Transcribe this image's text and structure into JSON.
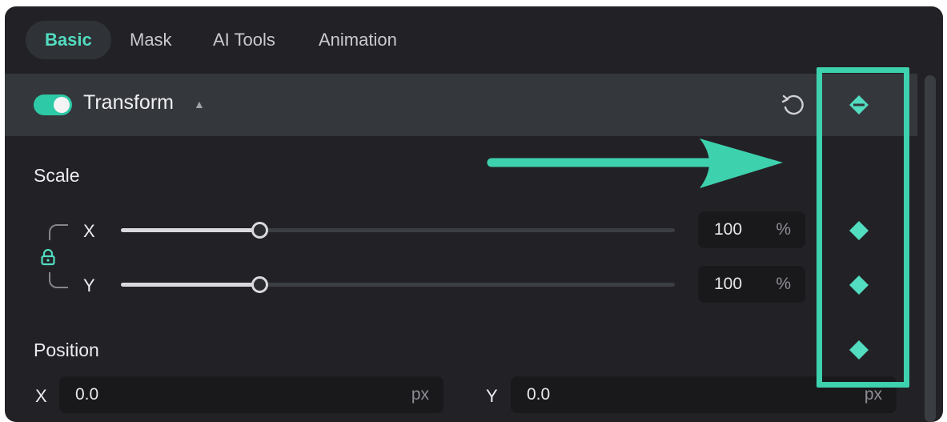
{
  "tabs": [
    {
      "label": "Basic",
      "active": true
    },
    {
      "label": "Mask",
      "active": false
    },
    {
      "label": "AI Tools",
      "active": false
    },
    {
      "label": "Animation",
      "active": false
    }
  ],
  "transform": {
    "title": "Transform",
    "enabled": true,
    "caret_icon": "caret-up-icon",
    "reset_icon": "reset-icon",
    "keyframe_icon": "keyframe-diamond-icon"
  },
  "scale": {
    "label": "Scale",
    "lock_icon": "lock-icon",
    "x": {
      "axis": "X",
      "value": "100",
      "unit": "%",
      "slider_fraction": 0.25
    },
    "y": {
      "axis": "Y",
      "value": "100",
      "unit": "%",
      "slider_fraction": 0.25
    }
  },
  "position": {
    "label": "Position",
    "x": {
      "axis": "X",
      "value": "0.0",
      "unit": "px"
    },
    "y": {
      "axis": "Y",
      "value": "0.0",
      "unit": "px"
    }
  },
  "annotation": {
    "arrow_icon": "arrow-right-icon",
    "highlight_color": "#3ed1ae"
  },
  "colors": {
    "accent": "#52dcc0",
    "panel_bg": "#222226",
    "header_bg": "#34373b",
    "keyframe": "#52dcc0"
  }
}
